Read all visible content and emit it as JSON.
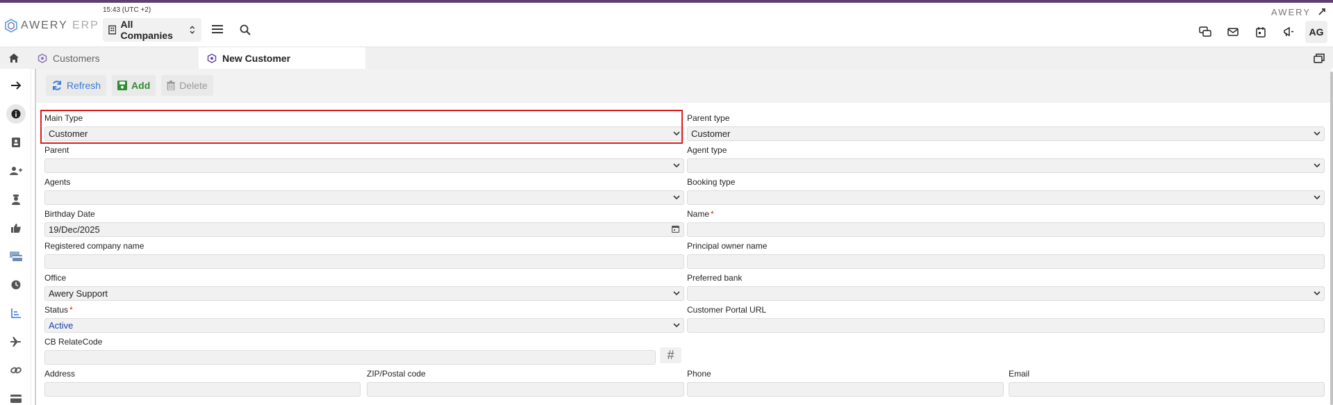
{
  "header": {
    "time": "15:43 (UTC +2)",
    "logo_main": "AWERY",
    "logo_sub": "ERP",
    "company": "All Companies",
    "brand_right": "AWERY",
    "avatar": "AG",
    "icons": [
      "chat-icon",
      "mail-icon",
      "calendar-icon",
      "megaphone-icon"
    ]
  },
  "tabs": [
    {
      "label": "Customers",
      "active": false
    },
    {
      "label": "New Customer",
      "active": true
    }
  ],
  "sidebar": {
    "icons": [
      "arrow-right-icon",
      "info-icon",
      "contact-card-icon",
      "add-user-icon",
      "agent-icon",
      "thumbs-up-icon",
      "payment-icon",
      "clock-icon",
      "chart-icon",
      "plane-icon",
      "link-icon",
      "card-icon"
    ]
  },
  "toolbar": {
    "refresh": "Refresh",
    "add": "Add",
    "delete": "Delete"
  },
  "form": {
    "main_type": {
      "label": "Main Type",
      "value": "Customer"
    },
    "parent_type": {
      "label": "Parent type",
      "value": "Customer"
    },
    "parent": {
      "label": "Parent",
      "value": ""
    },
    "agent_type": {
      "label": "Agent type",
      "value": ""
    },
    "agents": {
      "label": "Agents",
      "value": ""
    },
    "booking_type": {
      "label": "Booking type",
      "value": ""
    },
    "birthday_date": {
      "label": "Birthday Date",
      "value": "19/Dec/2025"
    },
    "name": {
      "label": "Name",
      "value": ""
    },
    "registered_company_name": {
      "label": "Registered company name",
      "value": ""
    },
    "principal_owner_name": {
      "label": "Principal owner name",
      "value": ""
    },
    "office": {
      "label": "Office",
      "value": "Awery Support"
    },
    "preferred_bank": {
      "label": "Preferred bank",
      "value": ""
    },
    "status": {
      "label": "Status",
      "value": "Active"
    },
    "customer_portal_url": {
      "label": "Customer Portal URL",
      "value": ""
    },
    "cb_relatecode": {
      "label": "CB RelateCode",
      "value": "",
      "button": "#"
    },
    "address": {
      "label": "Address",
      "value": ""
    },
    "zip": {
      "label": "ZIP/Postal code",
      "value": ""
    },
    "phone": {
      "label": "Phone",
      "value": ""
    },
    "email": {
      "label": "Email",
      "value": ""
    },
    "required_mark": "*"
  },
  "colors": {
    "accent": "#5b3f75",
    "highlight": "#e01b1b",
    "refresh": "#3a7ad9",
    "add": "#2f8c2f",
    "status_value": "#1f3fa8"
  }
}
